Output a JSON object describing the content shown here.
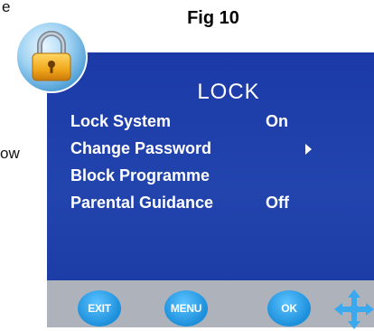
{
  "page": {
    "fragment_top": "e",
    "fragment_mid": "ow",
    "figure_label": "Fig 10"
  },
  "icons": {
    "lock_badge": "padlock-icon",
    "navigation": "four-direction-arrows-icon"
  },
  "menu": {
    "title": "LOCK",
    "items": [
      {
        "label": "Lock System",
        "value": "On",
        "has_arrow": false
      },
      {
        "label": "Change Password",
        "value": "",
        "has_arrow": true
      },
      {
        "label": "Block Programme",
        "value": "",
        "has_arrow": false
      },
      {
        "label": "Parental Guidance",
        "value": "Off",
        "has_arrow": false
      }
    ]
  },
  "bar": {
    "exit_label": "EXIT",
    "menu_label": "MENU",
    "ok_label": "OK"
  },
  "colors": {
    "panel_blue": "#1e3da7",
    "bar_gray": "#aeb3bb",
    "button_blue": "#2aa3e8",
    "lock_gold": "#e8a21a"
  }
}
